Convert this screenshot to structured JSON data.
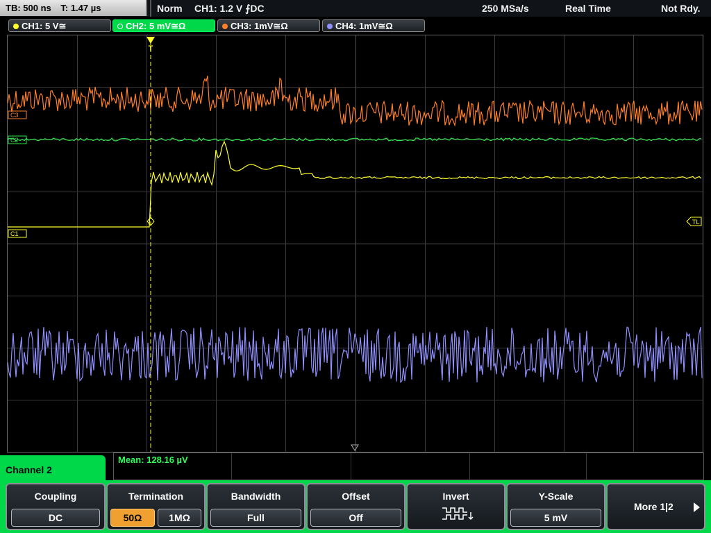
{
  "status": {
    "timebase": "TB: 500 ns",
    "trigger_time": "T: 1.47 µs",
    "trigger_mode": "Norm",
    "trigger_source": "CH1: 1.2 V ⨍DC",
    "sample_rate": "250 MSa/s",
    "acq_mode": "Real Time",
    "run_state": "Not Rdy."
  },
  "channels": [
    {
      "label": "CH1: 5 V≅",
      "color": "#ffff2a",
      "active": false
    },
    {
      "label": "CH2: 5 mV≅Ω",
      "color": "#2de84a",
      "active": true
    },
    {
      "label": "CH3: 1mV≅Ω",
      "color": "#ff7f2a",
      "active": false
    },
    {
      "label": "CH4: 1mV≅Ω",
      "color": "#9090ff",
      "active": false
    }
  ],
  "markers": {
    "c3": "C3",
    "c2": "C2",
    "c1": "C1",
    "trigger_level": "TL",
    "trigger_pos": "T"
  },
  "measurement": {
    "text": "Mean: 128.16 µV"
  },
  "menu": {
    "title": "Channel 2",
    "coupling_title": "Coupling",
    "coupling_value": "DC",
    "termination_title": "Termination",
    "termination_50": "50Ω",
    "termination_1m": "1MΩ",
    "bandwidth_title": "Bandwidth",
    "bandwidth_value": "Full",
    "offset_title": "Offset",
    "offset_value": "Off",
    "invert_title": "Invert",
    "yscale_title": "Y-Scale",
    "yscale_value": "5 mV",
    "more_label": "More 1|2"
  }
}
